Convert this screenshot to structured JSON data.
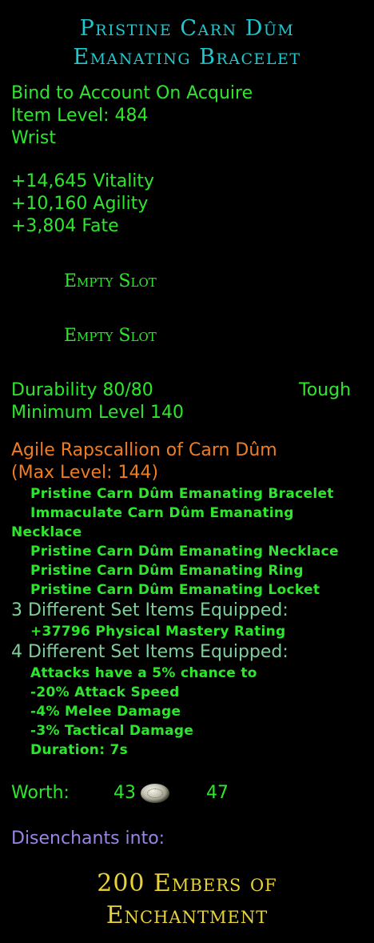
{
  "item": {
    "name_line1": "Pristine Carn Dûm",
    "name_line2": "Emanating Bracelet",
    "bind": "Bind to Account On Acquire",
    "item_level": "Item Level: 484",
    "slot": "Wrist",
    "stats": [
      "+14,645 Vitality",
      "+10,160 Agility",
      "+3,804 Fate"
    ],
    "empty_slots": [
      "Empty Slot",
      "Empty Slot"
    ],
    "durability": "Durability 80/80",
    "durability_type": "Tough",
    "min_level": "Minimum Level 140"
  },
  "set": {
    "name": "Agile Rapscallion of Carn Dûm",
    "max_level": "(Max Level: 144)",
    "pieces": [
      "Pristine Carn Dûm Emanating Bracelet",
      "Immaculate Carn Dûm Emanating",
      "Necklace",
      "Pristine Carn Dûm Emanating Necklace",
      "Pristine Carn Dûm Emanating Ring",
      "Pristine Carn Dûm Emanating Locket"
    ],
    "bonus3_header": "3 Different Set Items Equipped:",
    "bonus3_effects": [
      "+37796 Physical Mastery Rating"
    ],
    "bonus4_header": "4 Different Set Items Equipped:",
    "bonus4_effects": [
      "Attacks have a 5% chance to",
      "-20% Attack Speed",
      "-4% Melee Damage",
      "-3% Tactical Damage",
      "Duration: 7s"
    ]
  },
  "worth": {
    "label": "Worth:",
    "silver": "43",
    "copper": "47",
    "coin_icon": "silver-coin-icon"
  },
  "disenchant": {
    "label": "Disenchants into:",
    "result_line1": "200 Embers of",
    "result_line2": "Enchantment"
  },
  "colors": {
    "title": "#1ec8d0",
    "stat_green": "#2ee62e",
    "set_orange": "#ee7d22",
    "set_header": "#7fcf9a",
    "disenchant_purple": "#9a84e6",
    "embers_gold": "#e8d23a",
    "background": "#000000"
  }
}
